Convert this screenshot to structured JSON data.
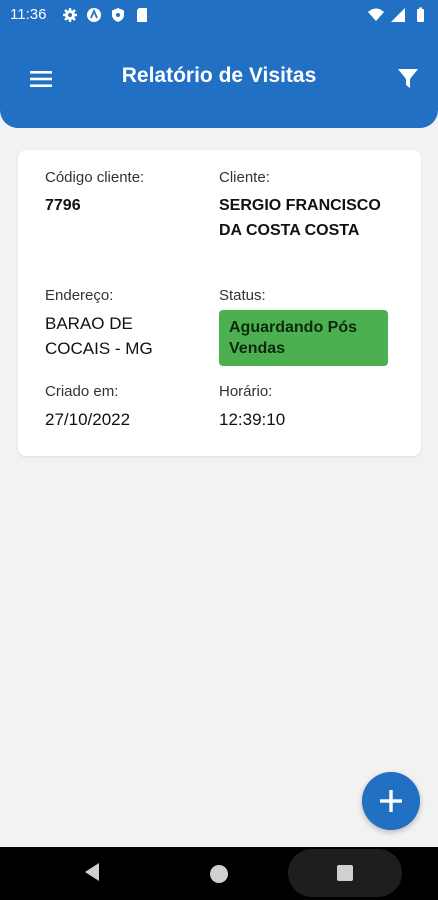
{
  "status_bar": {
    "time": "11:36",
    "left_icons": [
      "gear-icon",
      "android-icon",
      "shield-icon",
      "sd-card-icon"
    ],
    "right_icons": [
      "wifi-icon",
      "signal-icon",
      "battery-icon"
    ]
  },
  "header": {
    "title": "Relatório de Visitas",
    "background_color": "#2270c3"
  },
  "card": {
    "codigo_cliente_label": "Código cliente:",
    "codigo_cliente_value": "7796",
    "cliente_label": "Cliente:",
    "cliente_value": "SERGIO FRANCISCO DA COSTA COSTA",
    "endereco_label": "Endereço:",
    "endereco_value": "BARAO DE COCAIS - MG",
    "status_label": "Status:",
    "status_value": "Aguardando Pós Vendas",
    "status_color": "#4caf50",
    "criado_label": "Criado em:",
    "criado_value": "27/10/2022",
    "horario_label": "Horário:",
    "horario_value": "12:39:10"
  },
  "fab": {
    "icon": "plus-icon"
  },
  "nav_bar": {
    "icons": [
      "back-icon",
      "home-icon",
      "recents-icon"
    ]
  }
}
